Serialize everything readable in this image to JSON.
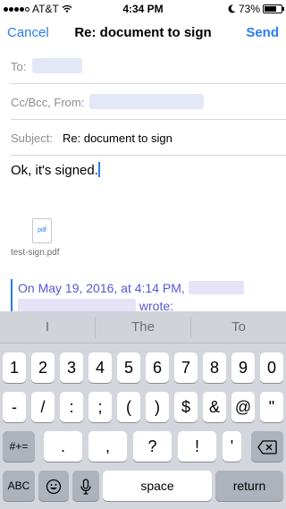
{
  "status": {
    "carrier": "AT&T",
    "time": "4:34 PM",
    "battery": "73%",
    "battery_level": 0.73
  },
  "nav": {
    "cancel": "Cancel",
    "title": "Re: document to sign",
    "send": "Send"
  },
  "fields": {
    "to_label": "To:",
    "ccbcc_label": "Cc/Bcc, From:",
    "subject_label": "Subject:",
    "subject_value": "Re: document to sign"
  },
  "body": {
    "text": "Ok, it's signed."
  },
  "attachment": {
    "icon_label": "pdf",
    "filename": "test-sign.pdf"
  },
  "quote": {
    "line1": "On May 19, 2016, at 4:14 PM,",
    "line2_tail": "wrote:"
  },
  "predictions": [
    "I",
    "The",
    "To"
  ],
  "keyboard": {
    "row1": [
      "1",
      "2",
      "3",
      "4",
      "5",
      "6",
      "7",
      "8",
      "9",
      "0"
    ],
    "row2": [
      "-",
      "/",
      ":",
      ";",
      "(",
      ")",
      "$",
      "&",
      "@",
      "\""
    ],
    "row3": [
      ".",
      ",",
      "?",
      "!",
      "'"
    ],
    "symbols_key": "#+=",
    "abc_key": "ABC",
    "space_key": "space",
    "return_key": "return"
  },
  "colors": {
    "accent": "#2a7bf2",
    "quote": "#5856d6",
    "keyboard_bg": "#d3d6dc"
  }
}
